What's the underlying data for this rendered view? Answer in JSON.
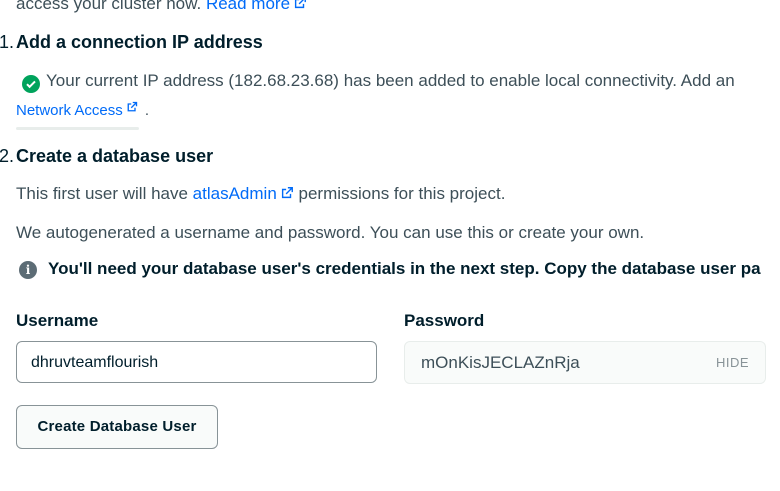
{
  "intro": {
    "text": "access your cluster now.",
    "read_more": "Read more"
  },
  "step1": {
    "number": "1.",
    "title": "Add a connection IP address",
    "message": "Your current IP address (182.68.23.68) has been added to enable local connectivity. Add an",
    "network_access_link": "Network Access",
    "trailing": "."
  },
  "step2": {
    "number": "2.",
    "title": "Create a database user",
    "permissions_prefix": "This first user will have",
    "permissions_link": "atlasAdmin",
    "permissions_suffix": "permissions for this project.",
    "autogen_text": "We autogenerated a username and password. You can use this or create your own.",
    "info_text": "You'll need your database user's credentials in the next step. Copy the database user pa"
  },
  "form": {
    "username_label": "Username",
    "username_value": "dhruvteamflourish",
    "password_label": "Password",
    "password_value": "mOnKisJECLAZnRja",
    "hide_label": "HIDE",
    "create_button": "Create Database User"
  },
  "colors": {
    "link": "#016bf8",
    "success": "#00a35c",
    "heading": "#001e2b",
    "body_text": "#3d4f58"
  },
  "icons": [
    "external-link-icon",
    "check-circle-icon",
    "info-icon"
  ]
}
